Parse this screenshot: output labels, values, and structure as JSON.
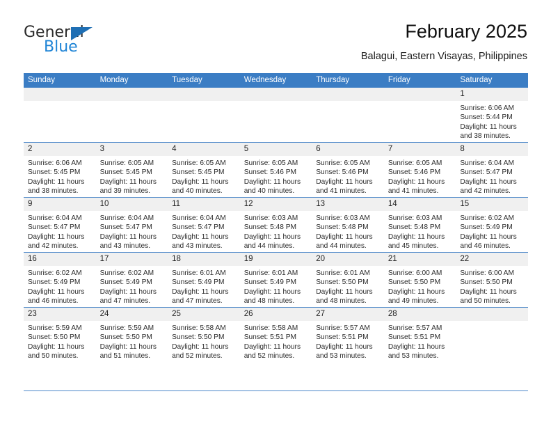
{
  "brand": {
    "name_part1": "General",
    "name_part2": "Blue",
    "triangle_color": "#1f6fb4",
    "blue_color": "#1f84d6"
  },
  "header": {
    "title": "February 2025",
    "location": "Balagui, Eastern Visayas, Philippines"
  },
  "theme": {
    "header_row_bg": "#3b7dc4",
    "daynum_bg": "#f0f0f0",
    "grid_line": "#4a86c8"
  },
  "weekdays": [
    "Sunday",
    "Monday",
    "Tuesday",
    "Wednesday",
    "Thursday",
    "Friday",
    "Saturday"
  ],
  "weeks": [
    [
      {
        "day": "",
        "empty": true,
        "sunrise": "",
        "sunset": "",
        "daylight1": "",
        "daylight2": ""
      },
      {
        "day": "",
        "empty": true,
        "sunrise": "",
        "sunset": "",
        "daylight1": "",
        "daylight2": ""
      },
      {
        "day": "",
        "empty": true,
        "sunrise": "",
        "sunset": "",
        "daylight1": "",
        "daylight2": ""
      },
      {
        "day": "",
        "empty": true,
        "sunrise": "",
        "sunset": "",
        "daylight1": "",
        "daylight2": ""
      },
      {
        "day": "",
        "empty": true,
        "sunrise": "",
        "sunset": "",
        "daylight1": "",
        "daylight2": ""
      },
      {
        "day": "",
        "empty": true,
        "sunrise": "",
        "sunset": "",
        "daylight1": "",
        "daylight2": ""
      },
      {
        "day": "1",
        "empty": false,
        "sunrise": "Sunrise: 6:06 AM",
        "sunset": "Sunset: 5:44 PM",
        "daylight1": "Daylight: 11 hours",
        "daylight2": "and 38 minutes."
      }
    ],
    [
      {
        "day": "2",
        "empty": false,
        "sunrise": "Sunrise: 6:06 AM",
        "sunset": "Sunset: 5:45 PM",
        "daylight1": "Daylight: 11 hours",
        "daylight2": "and 38 minutes."
      },
      {
        "day": "3",
        "empty": false,
        "sunrise": "Sunrise: 6:05 AM",
        "sunset": "Sunset: 5:45 PM",
        "daylight1": "Daylight: 11 hours",
        "daylight2": "and 39 minutes."
      },
      {
        "day": "4",
        "empty": false,
        "sunrise": "Sunrise: 6:05 AM",
        "sunset": "Sunset: 5:45 PM",
        "daylight1": "Daylight: 11 hours",
        "daylight2": "and 40 minutes."
      },
      {
        "day": "5",
        "empty": false,
        "sunrise": "Sunrise: 6:05 AM",
        "sunset": "Sunset: 5:46 PM",
        "daylight1": "Daylight: 11 hours",
        "daylight2": "and 40 minutes."
      },
      {
        "day": "6",
        "empty": false,
        "sunrise": "Sunrise: 6:05 AM",
        "sunset": "Sunset: 5:46 PM",
        "daylight1": "Daylight: 11 hours",
        "daylight2": "and 41 minutes."
      },
      {
        "day": "7",
        "empty": false,
        "sunrise": "Sunrise: 6:05 AM",
        "sunset": "Sunset: 5:46 PM",
        "daylight1": "Daylight: 11 hours",
        "daylight2": "and 41 minutes."
      },
      {
        "day": "8",
        "empty": false,
        "sunrise": "Sunrise: 6:04 AM",
        "sunset": "Sunset: 5:47 PM",
        "daylight1": "Daylight: 11 hours",
        "daylight2": "and 42 minutes."
      }
    ],
    [
      {
        "day": "9",
        "empty": false,
        "sunrise": "Sunrise: 6:04 AM",
        "sunset": "Sunset: 5:47 PM",
        "daylight1": "Daylight: 11 hours",
        "daylight2": "and 42 minutes."
      },
      {
        "day": "10",
        "empty": false,
        "sunrise": "Sunrise: 6:04 AM",
        "sunset": "Sunset: 5:47 PM",
        "daylight1": "Daylight: 11 hours",
        "daylight2": "and 43 minutes."
      },
      {
        "day": "11",
        "empty": false,
        "sunrise": "Sunrise: 6:04 AM",
        "sunset": "Sunset: 5:47 PM",
        "daylight1": "Daylight: 11 hours",
        "daylight2": "and 43 minutes."
      },
      {
        "day": "12",
        "empty": false,
        "sunrise": "Sunrise: 6:03 AM",
        "sunset": "Sunset: 5:48 PM",
        "daylight1": "Daylight: 11 hours",
        "daylight2": "and 44 minutes."
      },
      {
        "day": "13",
        "empty": false,
        "sunrise": "Sunrise: 6:03 AM",
        "sunset": "Sunset: 5:48 PM",
        "daylight1": "Daylight: 11 hours",
        "daylight2": "and 44 minutes."
      },
      {
        "day": "14",
        "empty": false,
        "sunrise": "Sunrise: 6:03 AM",
        "sunset": "Sunset: 5:48 PM",
        "daylight1": "Daylight: 11 hours",
        "daylight2": "and 45 minutes."
      },
      {
        "day": "15",
        "empty": false,
        "sunrise": "Sunrise: 6:02 AM",
        "sunset": "Sunset: 5:49 PM",
        "daylight1": "Daylight: 11 hours",
        "daylight2": "and 46 minutes."
      }
    ],
    [
      {
        "day": "16",
        "empty": false,
        "sunrise": "Sunrise: 6:02 AM",
        "sunset": "Sunset: 5:49 PM",
        "daylight1": "Daylight: 11 hours",
        "daylight2": "and 46 minutes."
      },
      {
        "day": "17",
        "empty": false,
        "sunrise": "Sunrise: 6:02 AM",
        "sunset": "Sunset: 5:49 PM",
        "daylight1": "Daylight: 11 hours",
        "daylight2": "and 47 minutes."
      },
      {
        "day": "18",
        "empty": false,
        "sunrise": "Sunrise: 6:01 AM",
        "sunset": "Sunset: 5:49 PM",
        "daylight1": "Daylight: 11 hours",
        "daylight2": "and 47 minutes."
      },
      {
        "day": "19",
        "empty": false,
        "sunrise": "Sunrise: 6:01 AM",
        "sunset": "Sunset: 5:49 PM",
        "daylight1": "Daylight: 11 hours",
        "daylight2": "and 48 minutes."
      },
      {
        "day": "20",
        "empty": false,
        "sunrise": "Sunrise: 6:01 AM",
        "sunset": "Sunset: 5:50 PM",
        "daylight1": "Daylight: 11 hours",
        "daylight2": "and 48 minutes."
      },
      {
        "day": "21",
        "empty": false,
        "sunrise": "Sunrise: 6:00 AM",
        "sunset": "Sunset: 5:50 PM",
        "daylight1": "Daylight: 11 hours",
        "daylight2": "and 49 minutes."
      },
      {
        "day": "22",
        "empty": false,
        "sunrise": "Sunrise: 6:00 AM",
        "sunset": "Sunset: 5:50 PM",
        "daylight1": "Daylight: 11 hours",
        "daylight2": "and 50 minutes."
      }
    ],
    [
      {
        "day": "23",
        "empty": false,
        "sunrise": "Sunrise: 5:59 AM",
        "sunset": "Sunset: 5:50 PM",
        "daylight1": "Daylight: 11 hours",
        "daylight2": "and 50 minutes."
      },
      {
        "day": "24",
        "empty": false,
        "sunrise": "Sunrise: 5:59 AM",
        "sunset": "Sunset: 5:50 PM",
        "daylight1": "Daylight: 11 hours",
        "daylight2": "and 51 minutes."
      },
      {
        "day": "25",
        "empty": false,
        "sunrise": "Sunrise: 5:58 AM",
        "sunset": "Sunset: 5:50 PM",
        "daylight1": "Daylight: 11 hours",
        "daylight2": "and 52 minutes."
      },
      {
        "day": "26",
        "empty": false,
        "sunrise": "Sunrise: 5:58 AM",
        "sunset": "Sunset: 5:51 PM",
        "daylight1": "Daylight: 11 hours",
        "daylight2": "and 52 minutes."
      },
      {
        "day": "27",
        "empty": false,
        "sunrise": "Sunrise: 5:57 AM",
        "sunset": "Sunset: 5:51 PM",
        "daylight1": "Daylight: 11 hours",
        "daylight2": "and 53 minutes."
      },
      {
        "day": "28",
        "empty": false,
        "sunrise": "Sunrise: 5:57 AM",
        "sunset": "Sunset: 5:51 PM",
        "daylight1": "Daylight: 11 hours",
        "daylight2": "and 53 minutes."
      },
      {
        "day": "",
        "empty": true,
        "sunrise": "",
        "sunset": "",
        "daylight1": "",
        "daylight2": ""
      }
    ]
  ]
}
